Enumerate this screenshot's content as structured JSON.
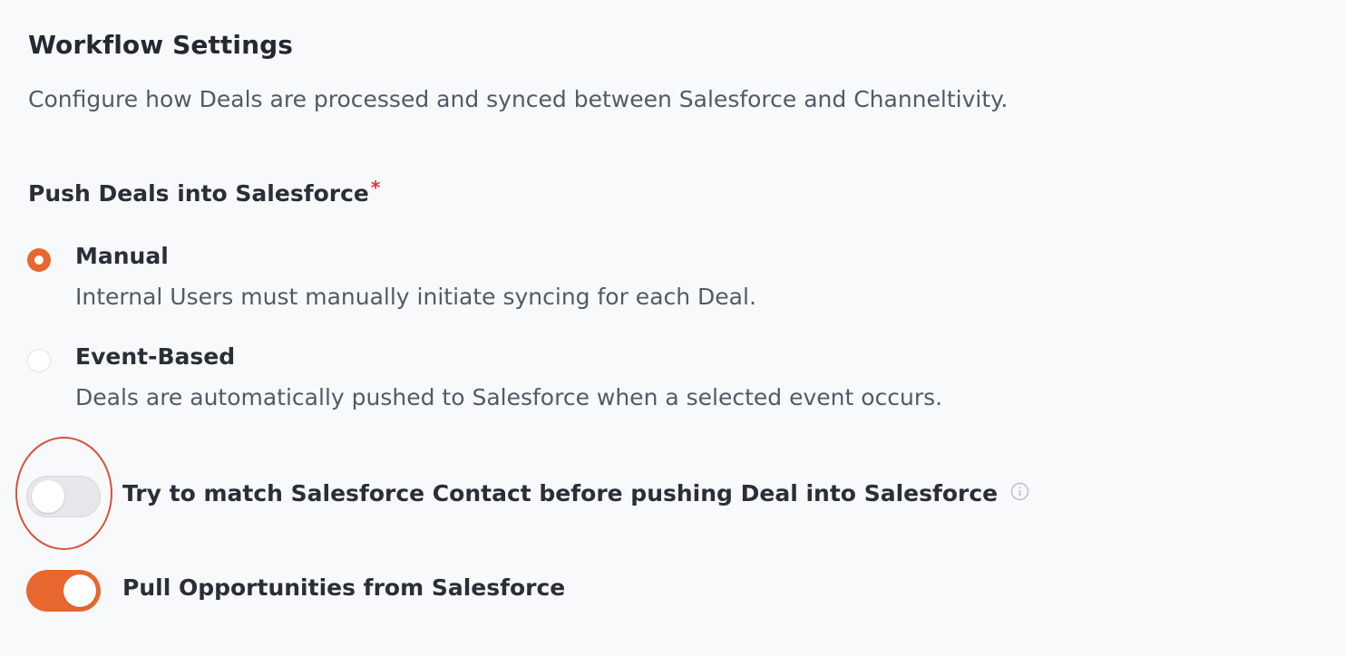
{
  "section": {
    "title": "Workflow Settings",
    "description": "Configure how Deals are processed and synced between Salesforce and Channeltivity."
  },
  "push_deals": {
    "label": "Push Deals into Salesforce",
    "required_marker": "*",
    "options": [
      {
        "title": "Manual",
        "description": "Internal Users must manually initiate syncing for each Deal.",
        "selected": true
      },
      {
        "title": "Event-Based",
        "description": "Deals are automatically pushed to Salesforce when a selected event occurs.",
        "selected": false
      }
    ]
  },
  "toggles": [
    {
      "label": "Try to match Salesforce Contact before pushing Deal into Salesforce",
      "enabled": false,
      "icon": "info-icon",
      "highlighted": true
    },
    {
      "label": "Pull Opportunities from Salesforce",
      "enabled": true
    }
  ],
  "colors": {
    "accent": "#e8672f",
    "required": "#d9363e",
    "highlight_ring": "#d4533b",
    "background": "#f8f9fb"
  }
}
